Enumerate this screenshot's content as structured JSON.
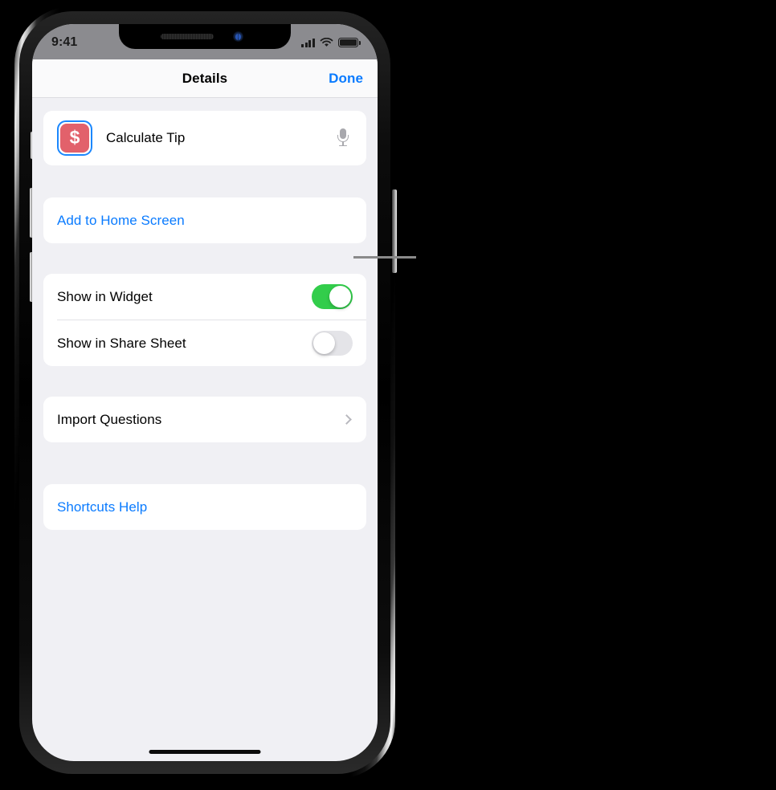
{
  "device": {
    "name": "iPhone",
    "status_bar": {
      "time": "9:41",
      "cellular_icon": "signal-bars-icon",
      "wifi_icon": "wifi-icon",
      "battery_icon": "battery-full-icon"
    },
    "home_indicator": "home-indicator"
  },
  "nav_bar": {
    "title": "Details",
    "done_label": "Done"
  },
  "shortcut": {
    "name": "Calculate Tip",
    "icon_glyph": "$",
    "icon_name": "dollar-sign-icon",
    "icon_color": "#E2616B",
    "icon_selection_color": "#1B87FD",
    "mic_icon": "microphone-icon"
  },
  "sections": {
    "home_screen": {
      "label": "Add to Home Screen",
      "link_color": "#0A7BFF"
    },
    "visibility": {
      "rows": [
        {
          "label": "Show in Widget",
          "toggle": "on"
        },
        {
          "label": "Show in Share Sheet",
          "toggle": "off"
        }
      ],
      "toggle_on_color": "#32CD4B",
      "toggle_off_color": "#E4E4E8"
    },
    "import": {
      "label": "Import Questions",
      "accessory": "chevron-right-icon"
    },
    "help": {
      "label": "Shortcuts Help",
      "link_color": "#0A7BFF"
    }
  },
  "annotation": {
    "leader_line_color": "#8A8A8A",
    "points_to": "Add to Home Screen"
  }
}
